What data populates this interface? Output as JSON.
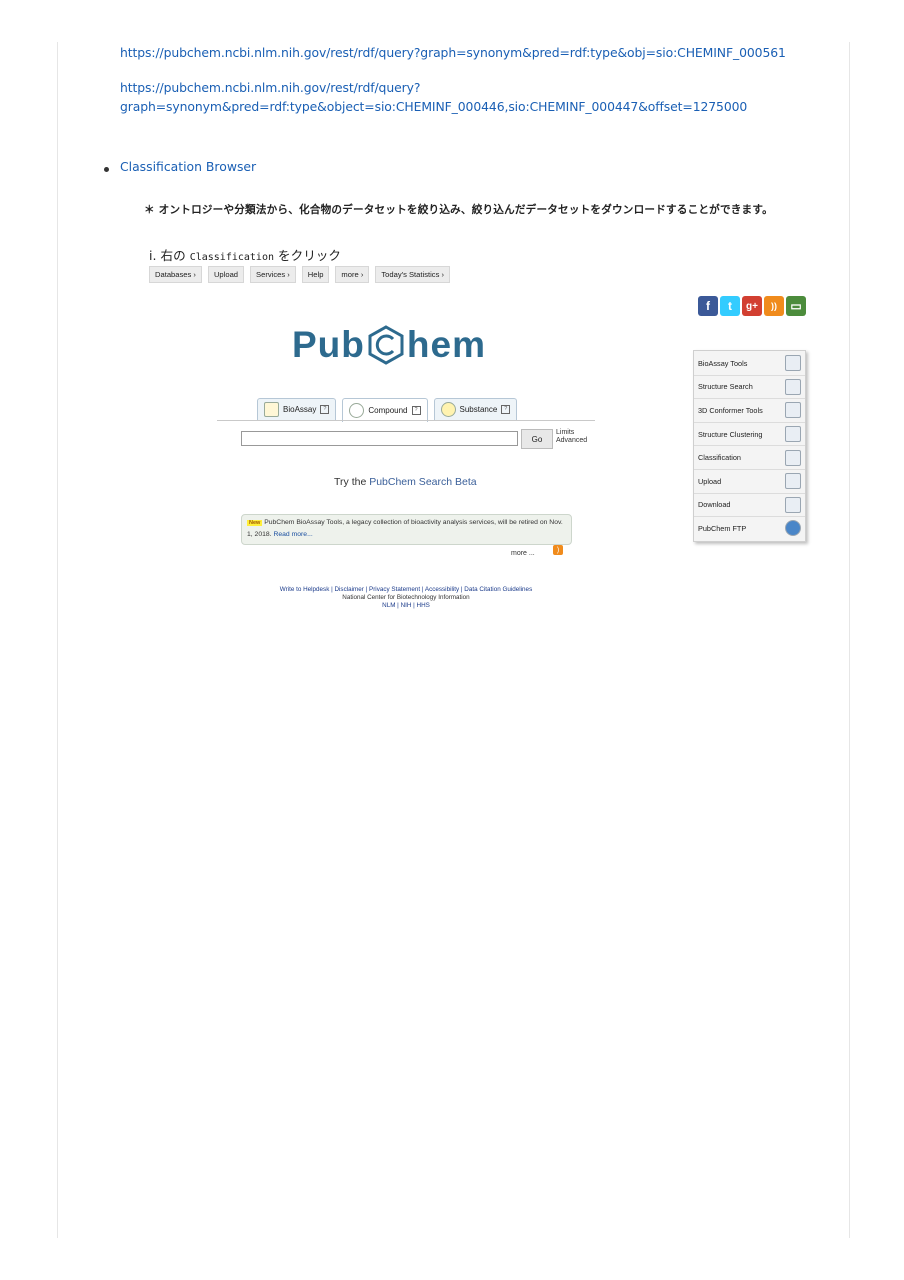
{
  "links": {
    "url1": "https://pubchem.ncbi.nlm.nih.gov/rest/rdf/query?graph=synonym&pred=rdf:type&obj=sio:CHEMINF_000561",
    "url2a": "https://pubchem.ncbi.nlm.nih.gov/rest/rdf/query?",
    "url2b": "graph=synonym&pred=rdf:type&object=sio:CHEMINF_000446,sio:CHEMINF_000447&offset=1275000"
  },
  "section": {
    "bullet_link": "Classification Browser",
    "note": "＊ オントロジーや分類法から、化合物のデータセットを絞り込み、絞り込んだデータセットをダウンロードすることができます。",
    "step_prefix": "i. 右の ",
    "step_code": "Classification",
    "step_suffix": " をクリック"
  },
  "pubchem": {
    "nav": [
      "Databases ›",
      "Upload",
      "Services ›",
      "Help",
      "more ›",
      "Today's Statistics ›"
    ],
    "social_icons": [
      {
        "name": "facebook-icon",
        "glyph": "f",
        "color": "#3b5998"
      },
      {
        "name": "twitter-icon",
        "glyph": "t",
        "color": "#33ccff"
      },
      {
        "name": "google-plus-icon",
        "glyph": "g+",
        "color": "#d23f31"
      },
      {
        "name": "rss-icon",
        "glyph": "))",
        "color": "#f08b1c"
      },
      {
        "name": "feedback-icon",
        "glyph": "▭",
        "color": "#4c8c3c"
      }
    ],
    "logo_left": "Pub",
    "logo_right": "hem",
    "tabs": {
      "bioassay": "BioAssay",
      "compound": "Compound",
      "substance": "Substance"
    },
    "search": {
      "value": "",
      "go": "Go",
      "limits": "Limits",
      "advanced": "Advanced"
    },
    "beta": {
      "prefix": "Try the ",
      "link": "PubChem Search Beta"
    },
    "news": {
      "tag": "New",
      "text": "PubChem BioAssay Tools, a legacy collection of bioactivity analysis services, will be retired on Nov. 1, 2018.",
      "read_more": "Read more..."
    },
    "more": "more ...",
    "footer": {
      "line1": "Write to Helpdesk | Disclaimer | Privacy Statement | Accessibility | Data Citation Guidelines",
      "line2": "National Center for Biotechnology Information",
      "line3": "NLM | NIH | HHS"
    },
    "tools": [
      "BioAssay Tools",
      "Structure Search",
      "3D Conformer Tools",
      "Structure Clustering",
      "Classification",
      "Upload",
      "Download",
      "PubChem FTP"
    ]
  }
}
